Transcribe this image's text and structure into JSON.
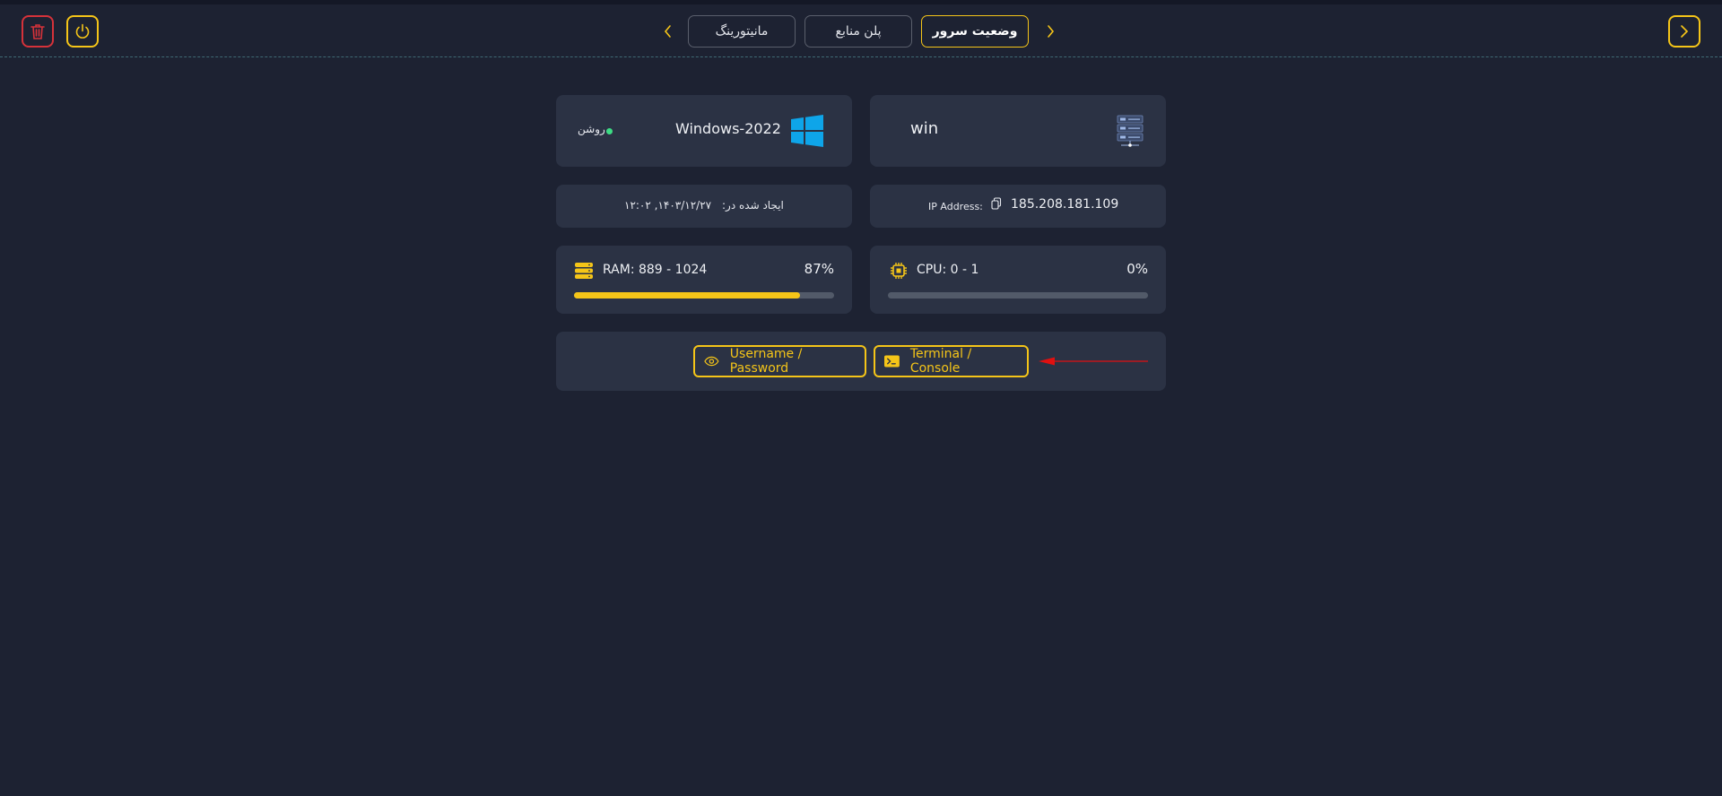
{
  "header": {
    "tabs": [
      {
        "label": "مانیتورینگ",
        "active": false
      },
      {
        "label": "پلن منابع",
        "active": false
      },
      {
        "label": "وضعیت سرور",
        "active": true
      }
    ]
  },
  "server": {
    "name": "win",
    "os": "Windows-2022",
    "status": "روشن",
    "status_color": "#3ddc84",
    "ip_label": "IP Address:",
    "ip": "185.208.181.109",
    "created_label": "ایجاد شده در:",
    "created_value": "۱۴۰۳/۱۲/۲۷, ۱۲:۰۲"
  },
  "resources": {
    "ram": {
      "label": "RAM: 889 - 1024",
      "percent": "87%",
      "value": 0.87
    },
    "cpu": {
      "label": "CPU: 0 - 1",
      "percent": "0%",
      "value": 0.0
    }
  },
  "actions": {
    "credentials": "Username / Password",
    "console": "Terminal / Console"
  },
  "colors": {
    "accent": "#f5c518",
    "danger": "#d6323a",
    "background": "#1d2232",
    "card": "#2b3244",
    "annotation": "#e01010"
  }
}
